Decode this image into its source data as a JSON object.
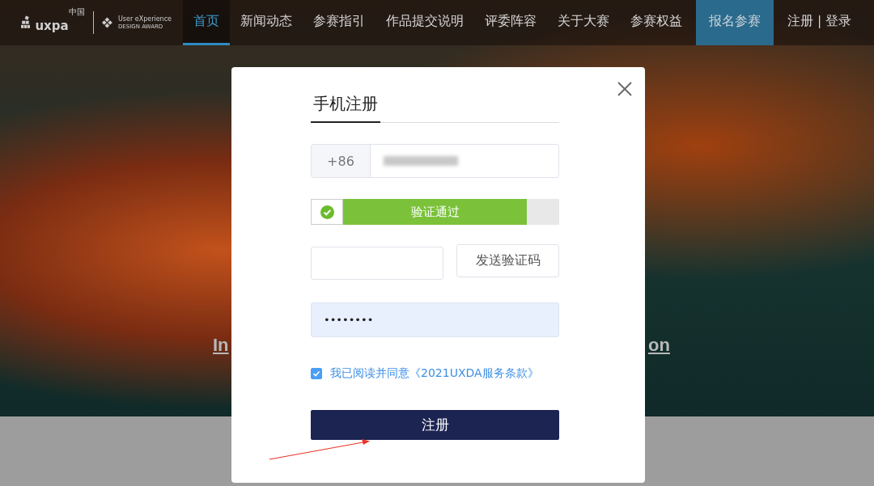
{
  "header": {
    "logo": {
      "name": "uxpa",
      "region": "中国",
      "award_title": "User eXperience",
      "award_subtitle": "DESIGN AWARD"
    },
    "nav": [
      {
        "label": "首页",
        "selected": true,
        "kind": "link"
      },
      {
        "label": "新闻动态",
        "selected": false,
        "kind": "link"
      },
      {
        "label": "参赛指引",
        "selected": false,
        "kind": "link"
      },
      {
        "label": "作品提交说明",
        "selected": false,
        "kind": "link"
      },
      {
        "label": "评委阵容",
        "selected": false,
        "kind": "link"
      },
      {
        "label": "关于大赛",
        "selected": false,
        "kind": "link"
      },
      {
        "label": "参赛权益",
        "selected": false,
        "kind": "link"
      },
      {
        "label": "报名参赛",
        "selected": false,
        "kind": "cta"
      },
      {
        "label": "注册 | 登录",
        "selected": false,
        "kind": "link"
      }
    ]
  },
  "hero": {
    "headline_left": "In",
    "headline_right": "on"
  },
  "dialog": {
    "tabs": [
      {
        "label": "手机注册",
        "selected": true
      }
    ],
    "phone": {
      "prefix": "+86",
      "blurred": true
    },
    "slider": {
      "label": "验证通过",
      "verified": true,
      "level": 0.87
    },
    "code": {
      "button": "发送验证码"
    },
    "password": {
      "value": "••••••••"
    },
    "agreement": {
      "checked": true,
      "text": "我已阅读并同意《2021UXDA服务条款》"
    },
    "submit": "注册"
  },
  "annotation": {
    "kind": "arrow"
  }
}
